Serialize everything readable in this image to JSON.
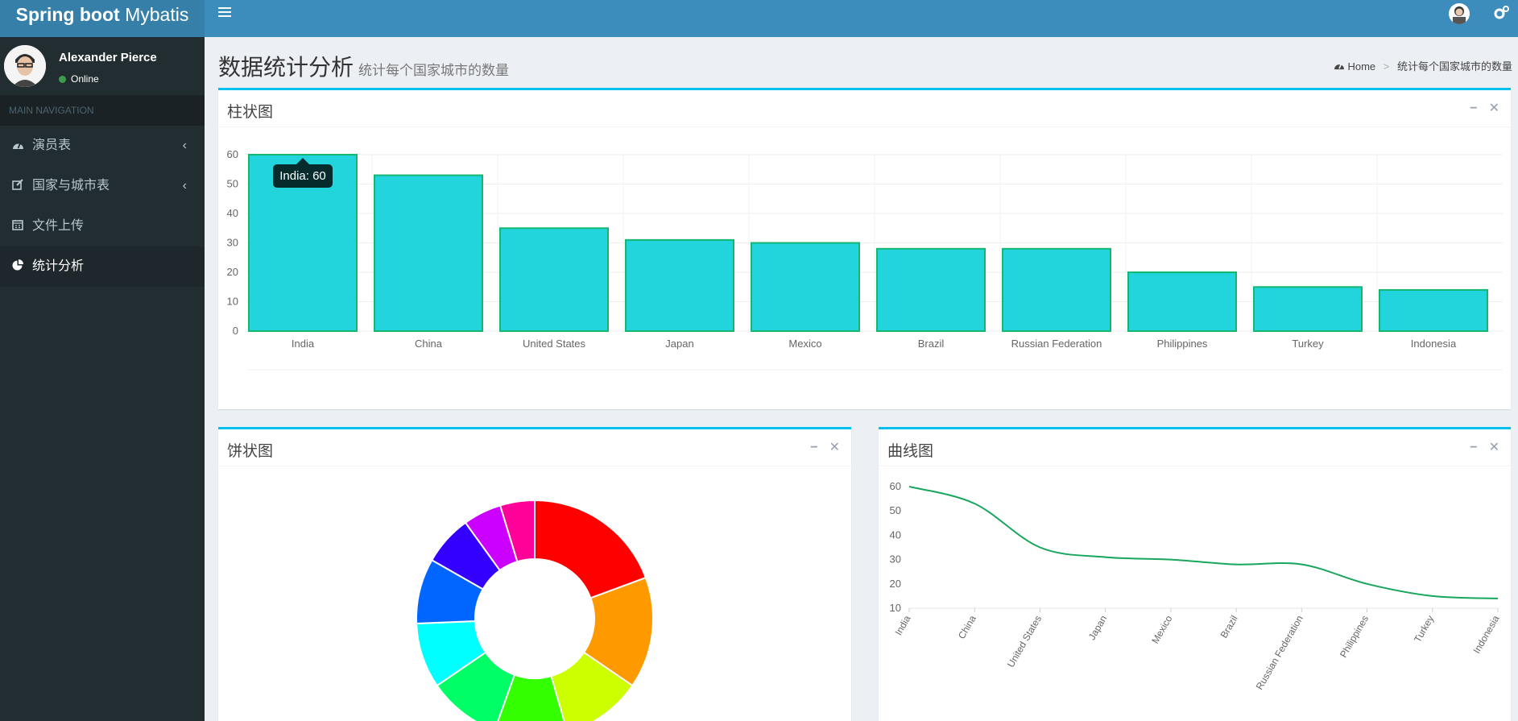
{
  "app": {
    "logo_bold": "Spring boot",
    "logo_light": "Mybatis"
  },
  "user": {
    "name": "Alexander Pierce",
    "status": "Online"
  },
  "sidebar": {
    "header": "MAIN NAVIGATION",
    "items": [
      {
        "label": "演员表",
        "icon": "dashboard-icon",
        "has_arrow": true
      },
      {
        "label": "国家与城市表",
        "icon": "edit-icon",
        "has_arrow": true
      },
      {
        "label": "文件上传",
        "icon": "calendar-icon",
        "has_arrow": false
      },
      {
        "label": "统计分析",
        "icon": "pie-chart-icon",
        "has_arrow": false,
        "active": true
      }
    ]
  },
  "page": {
    "title": "数据统计分析",
    "subtitle": "统计每个国家城市的数量",
    "breadcrumb_home": "Home",
    "breadcrumb_current": "统计每个国家城市的数量"
  },
  "boxes": {
    "bar_title": "柱状图",
    "pie_title": "饼状图",
    "line_title": "曲线图"
  },
  "colors": {
    "bar_fill": "#22d5dd",
    "bar_stroke": "#14b670",
    "line_stroke": "#17a65b",
    "header": "#3c8dbc",
    "sidebar": "#222d32",
    "box_accent": "#00c0ef"
  },
  "tooltip": {
    "text": "India: 60"
  },
  "chart_data": [
    {
      "type": "bar",
      "categories": [
        "India",
        "China",
        "United States",
        "Japan",
        "Mexico",
        "Brazil",
        "Russian Federation",
        "Philippines",
        "Turkey",
        "Indonesia"
      ],
      "values": [
        60,
        53,
        35,
        31,
        30,
        28,
        28,
        20,
        15,
        14
      ],
      "ylim": [
        0,
        60
      ],
      "yticks": [
        0,
        10,
        20,
        30,
        40,
        50,
        60
      ],
      "grid": true
    },
    {
      "type": "pie",
      "donut": true,
      "slices": [
        {
          "value": 18.5,
          "color": "#ff0000"
        },
        {
          "value": 14.5,
          "color": "#ff9900"
        },
        {
          "value": 10.5,
          "color": "#ccff00"
        },
        {
          "value": 9.5,
          "color": "#33ff00"
        },
        {
          "value": 9.5,
          "color": "#00ff66"
        },
        {
          "value": 8.5,
          "color": "#00ffff"
        },
        {
          "value": 8.5,
          "color": "#0066ff"
        },
        {
          "value": 6.5,
          "color": "#3300ff"
        },
        {
          "value": 5,
          "color": "#cc00ff"
        },
        {
          "value": 4.5,
          "color": "#ff0099"
        }
      ]
    },
    {
      "type": "line",
      "categories": [
        "India",
        "China",
        "United States",
        "Japan",
        "Mexico",
        "Brazil",
        "Russian Federation",
        "Philippines",
        "Turkey",
        "Indonesia"
      ],
      "values": [
        60,
        53,
        35,
        31,
        30,
        28,
        28,
        20,
        15,
        14
      ],
      "ylim": [
        10,
        60
      ],
      "yticks": [
        10,
        20,
        30,
        40,
        50,
        60
      ]
    }
  ]
}
